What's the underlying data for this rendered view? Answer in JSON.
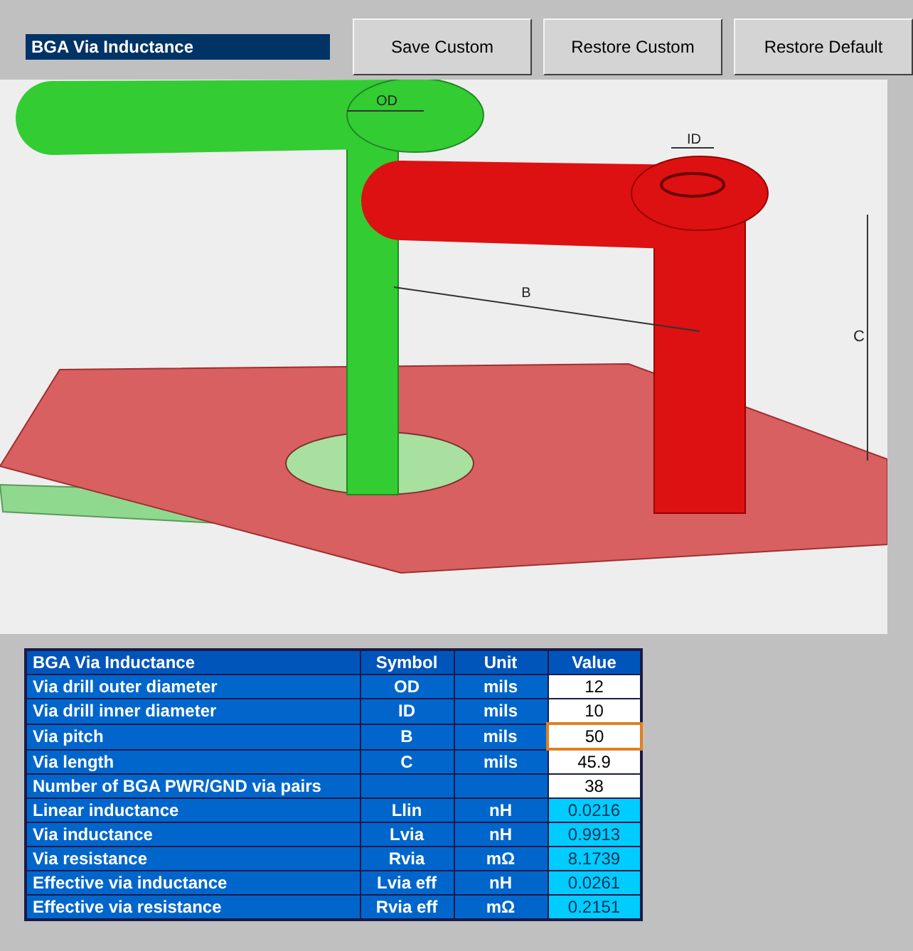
{
  "title": "BGA Via Inductance",
  "buttons": [
    "Save Custom",
    "Restore Custom",
    "Restore Default"
  ],
  "diagram": {
    "labels": [
      "OD",
      "ID",
      "B",
      "C"
    ]
  },
  "table": {
    "columns": [
      "BGA Via Inductance",
      "Symbol",
      "Unit",
      "Value"
    ],
    "rows": [
      {
        "name": "Via drill outer diameter",
        "symbol": "OD",
        "unit": "mils",
        "value": "12",
        "kind": "input",
        "selected": false
      },
      {
        "name": "Via drill inner diameter",
        "symbol": "ID",
        "unit": "mils",
        "value": "10",
        "kind": "input",
        "selected": false
      },
      {
        "name": "Via pitch",
        "symbol": "B",
        "unit": "mils",
        "value": "50",
        "kind": "input",
        "selected": true
      },
      {
        "name": "Via length",
        "symbol": "C",
        "unit": "mils",
        "value": "45.9",
        "kind": "input",
        "selected": false
      },
      {
        "name": "Number of BGA PWR/GND via pairs",
        "value": "38",
        "kind": "input",
        "selected": false
      },
      {
        "name": "Linear inductance",
        "symbol": "Llin",
        "unit": "nH",
        "value": "0.0216",
        "kind": "output",
        "selected": false
      },
      {
        "name": "Via inductance",
        "symbol": "Lvia",
        "unit": "nH",
        "value": "0.9913",
        "kind": "output",
        "selected": false
      },
      {
        "name": "Via resistance",
        "symbol": "Rvia",
        "unit": "mΩ",
        "value": "8.1739",
        "kind": "output",
        "selected": false
      },
      {
        "name": "Effective via inductance",
        "symbol": "Lvia eff",
        "unit": "nH",
        "value": "0.0261",
        "kind": "output",
        "selected": false
      },
      {
        "name": "Effective via resistance",
        "symbol": "Rvia eff",
        "unit": "mΩ",
        "value": "0.2151",
        "kind": "output",
        "selected": false
      }
    ]
  }
}
